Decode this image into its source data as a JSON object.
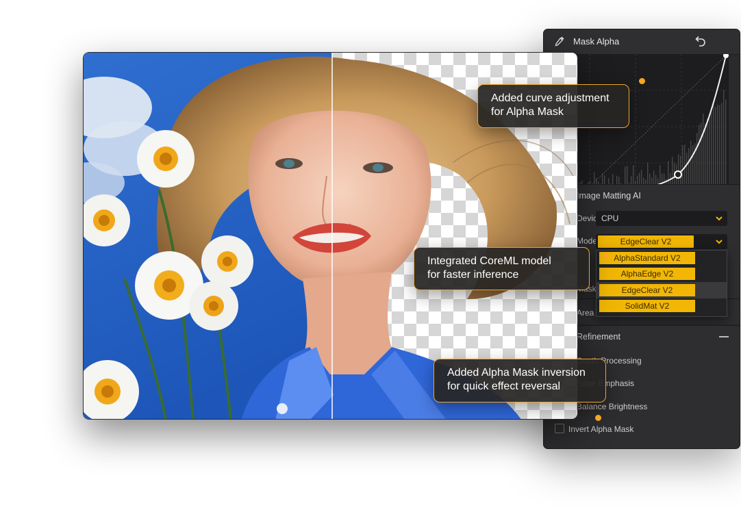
{
  "panel": {
    "title": "Mask Alpha",
    "matting": {
      "title": "Image Matting AI",
      "device_label": "Device",
      "device_value": "CPU",
      "model_label": "Model",
      "model_selected": "EdgeClear  V2",
      "options": [
        "AlphaStandard  V2",
        "AlphaEdge  V2",
        "EdgeClear  V2",
        "SolidMat  V2"
      ],
      "mask_label": "Mask",
      "area_select_label": "Area Select"
    },
    "refinement": {
      "title": "Refinement",
      "items": [
        "Depth Processing",
        "Edge Emphasis",
        "Balance Brightness"
      ],
      "invert_label": "Invert Alpha Mask"
    }
  },
  "callouts": {
    "curve": [
      "Added curve adjustment",
      "for Alpha Mask"
    ],
    "coreml": [
      "Integrated CoreML model",
      "for faster inference"
    ],
    "invert": [
      "Added Alpha Mask inversion",
      "for quick effect reversal"
    ]
  },
  "colors": {
    "accent": "#f2b705",
    "callout_border": "#f0a52a",
    "panel_bg": "#2a2a2c"
  }
}
